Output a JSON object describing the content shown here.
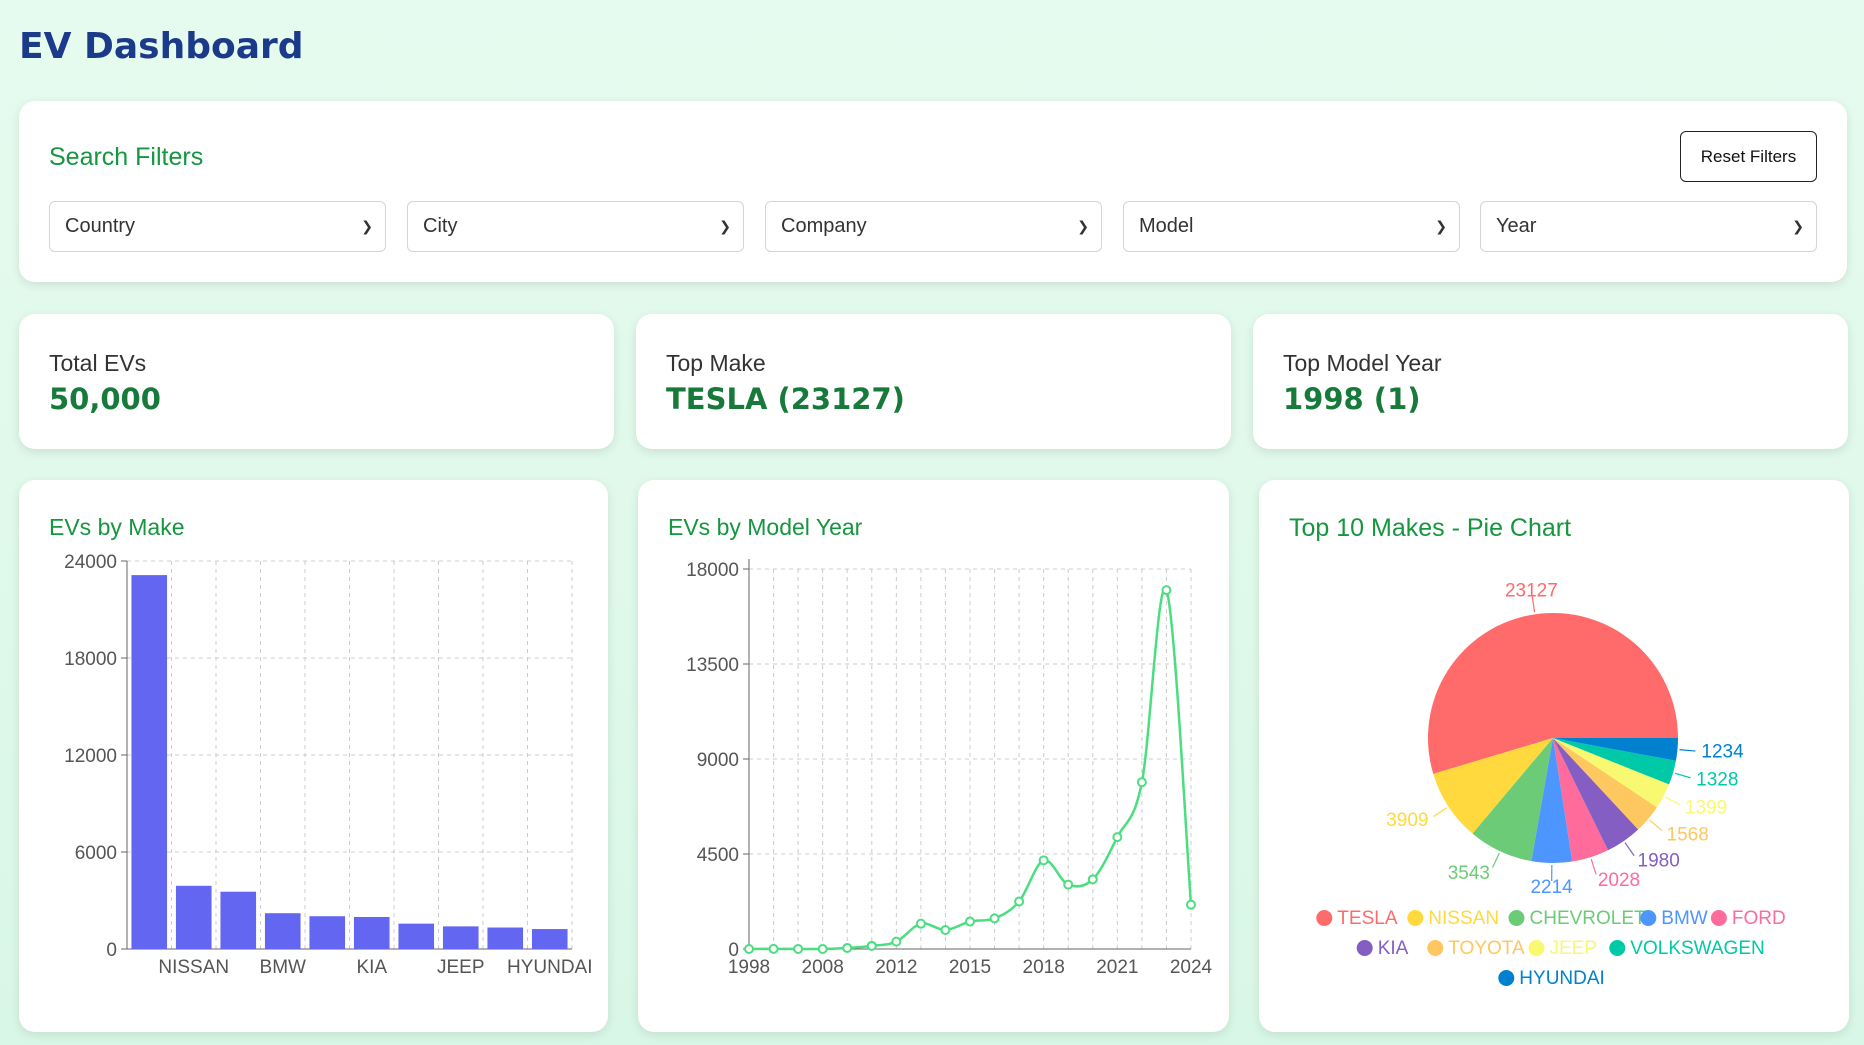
{
  "header": {
    "title": "EV Dashboard"
  },
  "filters": {
    "title": "Search Filters",
    "reset_label": "Reset Filters",
    "selects": [
      {
        "label": "Country"
      },
      {
        "label": "City"
      },
      {
        "label": "Company"
      },
      {
        "label": "Model"
      },
      {
        "label": "Year"
      }
    ]
  },
  "stats": [
    {
      "label": "Total EVs",
      "value": "50,000"
    },
    {
      "label": "Top Make",
      "value": "TESLA (23127)"
    },
    {
      "label": "Top Model Year",
      "value": "1998 (1)"
    }
  ],
  "chart_data": [
    {
      "type": "bar",
      "title": "EVs by Make",
      "categories": [
        "TESLA",
        "NISSAN",
        "CHEVROLET",
        "BMW",
        "FORD",
        "KIA",
        "TOYOTA",
        "JEEP",
        "VOLKSWAGEN",
        "HYUNDAI"
      ],
      "tick_labels_shown": [
        "",
        "NISSAN",
        "",
        "BMW",
        "",
        "KIA",
        "",
        "JEEP",
        "",
        "HYUNDAI"
      ],
      "values": [
        23127,
        3909,
        3543,
        2214,
        2028,
        1980,
        1568,
        1399,
        1328,
        1234
      ],
      "ylim": [
        0,
        24000
      ],
      "yticks": [
        0,
        6000,
        12000,
        18000,
        24000
      ],
      "grid": true,
      "color": "#6366f1"
    },
    {
      "type": "line",
      "title": "EVs by Model Year",
      "x": [
        1998,
        2000,
        2002,
        2008,
        2010,
        2011,
        2012,
        2013,
        2014,
        2015,
        2016,
        2017,
        2018,
        2019,
        2020,
        2021,
        2022,
        2023,
        2024
      ],
      "xtick_labels": [
        "1998",
        "2008",
        "2012",
        "2015",
        "2018",
        "2021",
        "2024"
      ],
      "values": [
        1,
        5,
        2,
        2,
        50,
        150,
        350,
        1200,
        900,
        1300,
        1450,
        2250,
        4200,
        3050,
        3300,
        5300,
        7900,
        17000,
        2100
      ],
      "ylim": [
        0,
        18000
      ],
      "yticks": [
        0,
        4500,
        9000,
        13500,
        18000
      ],
      "grid": true,
      "color": "#4ade80"
    },
    {
      "type": "pie",
      "title": "Top 10 Makes - Pie Chart",
      "slices": [
        {
          "label": "TESLA",
          "value": 23127,
          "color": "#ff6b6b"
        },
        {
          "label": "NISSAN",
          "value": 3909,
          "color": "#ffd93d"
        },
        {
          "label": "CHEVROLET",
          "value": 3543,
          "color": "#6bcb77"
        },
        {
          "label": "BMW",
          "value": 2214,
          "color": "#4d96ff"
        },
        {
          "label": "FORD",
          "value": 2028,
          "color": "#ff6b9a"
        },
        {
          "label": "KIA",
          "value": 1980,
          "color": "#845ec2"
        },
        {
          "label": "TOYOTA",
          "value": 1568,
          "color": "#ffc75f"
        },
        {
          "label": "JEEP",
          "value": 1399,
          "color": "#f9f871"
        },
        {
          "label": "VOLKSWAGEN",
          "value": 1328,
          "color": "#00c9a7"
        },
        {
          "label": "HYUNDAI",
          "value": 1234,
          "color": "#0081cf"
        }
      ],
      "legend": "bottom"
    }
  ]
}
